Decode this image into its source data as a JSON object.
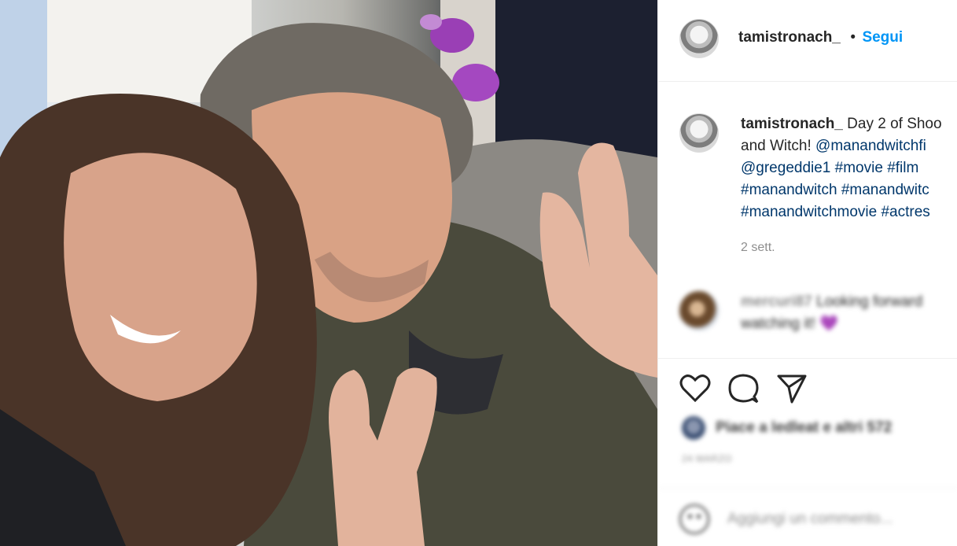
{
  "post": {
    "author": "tamistronach_",
    "separator": "•",
    "follow_label": "Segui"
  },
  "caption": {
    "author": "tamistronach_",
    "text_start": "Day 2 of Shoo",
    "line2_plain": "and Witch!",
    "line2_link": "@manandwitchfi",
    "line3": [
      "@gregeddie1",
      "#movie",
      "#film"
    ],
    "line4": [
      "#manandwitch",
      "#manandwitc"
    ],
    "line5": [
      "#manandwitchmovie",
      "#actres"
    ],
    "time": "2 sett."
  },
  "comment": {
    "user": "mercuri87",
    "text": "Looking forward watching it!",
    "emoji": "💜"
  },
  "actions": {
    "likes_text": "Piace a ledleat e altri 572",
    "date": "24 MARZO"
  },
  "add_comment": {
    "placeholder": "Aggiungi un commento..."
  },
  "colors": {
    "link": "#00376b",
    "follow": "#0095f6",
    "secondary": "#8e8e8e",
    "text": "#262626"
  }
}
